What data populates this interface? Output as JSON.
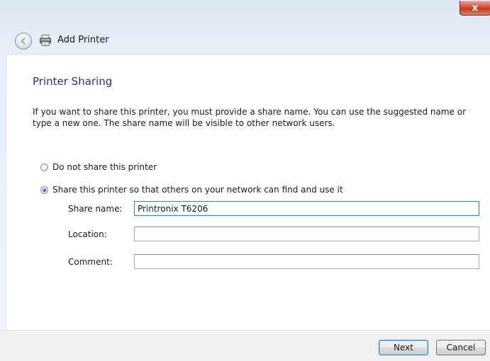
{
  "window": {
    "title": "Add Printer",
    "close_label": "x"
  },
  "page": {
    "heading": "Printer Sharing",
    "description": "If you want to share this printer, you must provide a share name. You can use the suggested name or type a new one. The share name will be visible to other network users."
  },
  "sharing": {
    "option_no_share": "Do not share this printer",
    "option_share": "Share this printer so that others on your network can find and use it",
    "selected": "share"
  },
  "fields": {
    "share_name_label": "Share name:",
    "share_name_value": "Printronix T6206",
    "location_label": "Location:",
    "location_value": "",
    "comment_label": "Comment:",
    "comment_value": ""
  },
  "footer": {
    "next_label": "Next",
    "cancel_label": "Cancel"
  },
  "icons": {
    "back": "back-arrow-icon",
    "printer": "printer-icon",
    "close": "close-icon"
  }
}
